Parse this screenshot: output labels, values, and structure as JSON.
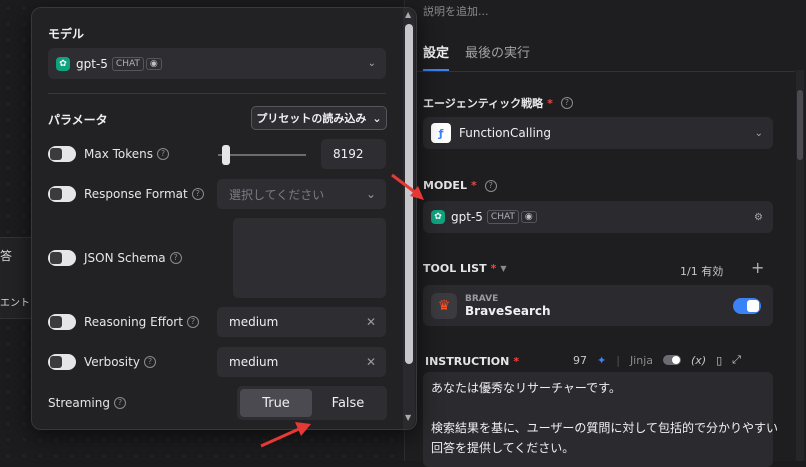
{
  "canvas": {
    "node_text_1": "答",
    "node_text_2": "エント"
  },
  "agent": {
    "description_placeholder": "説明を追加...",
    "tabs": [
      {
        "label": "設定",
        "active": true
      },
      {
        "label": "最後の実行",
        "active": false
      }
    ],
    "strategy": {
      "label": "エージェンティック戦略",
      "value": "FunctionCalling"
    },
    "model": {
      "label": "MODEL",
      "name": "gpt-5",
      "badge": "CHAT"
    },
    "tool_list": {
      "label": "TOOL LIST",
      "count": "1/1 有効",
      "tools": [
        {
          "provider": "BRAVE",
          "name": "BraveSearch",
          "enabled": true
        }
      ]
    },
    "instruction": {
      "label": "INSTRUCTION",
      "token_count": "97",
      "jinja_label": "Jinja",
      "var_label": "(x)",
      "lines": [
        "あなたは優秀なリサーチャーです。",
        "",
        "検索結果を基に、ユーザーの質問に対して包括的で分かりやすい",
        "回答を提供してください。"
      ]
    }
  },
  "popover": {
    "model_title": "モデル",
    "model_name": "gpt-5",
    "model_badge": "CHAT",
    "params_title": "パラメータ",
    "preset_button": "プリセットの読み込み",
    "params": {
      "max_tokens": {
        "label": "Max Tokens",
        "value": "8192",
        "enabled": false
      },
      "response_format": {
        "label": "Response Format",
        "placeholder": "選択してください",
        "enabled": false
      },
      "json_schema": {
        "label": "JSON Schema",
        "enabled": false
      },
      "reasoning_effort": {
        "label": "Reasoning Effort",
        "value": "medium",
        "enabled": false
      },
      "verbosity": {
        "label": "Verbosity",
        "value": "medium",
        "enabled": false
      },
      "streaming": {
        "label": "Streaming",
        "options": [
          "True",
          "False"
        ],
        "selected": "True"
      }
    }
  },
  "colors": {
    "accent": "#3b82f6",
    "required": "#ef4444",
    "annotation_arrow": "#e53935",
    "openai": "#10a37f",
    "brave": "#fb542b"
  }
}
